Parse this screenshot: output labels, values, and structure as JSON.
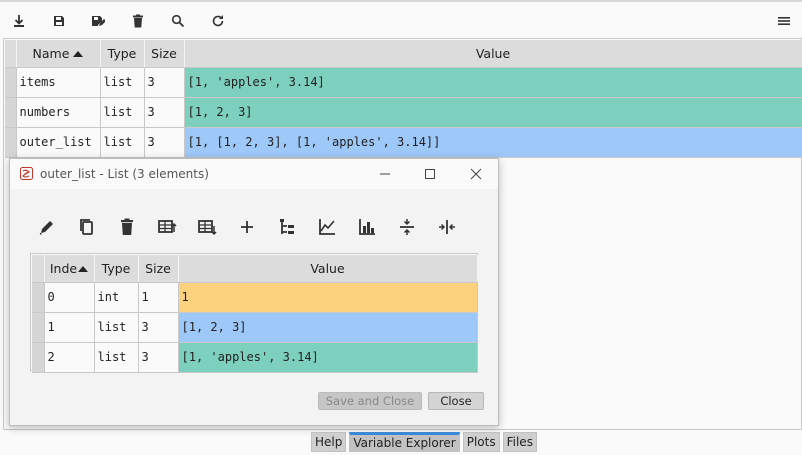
{
  "toolbar": {
    "icons": [
      "import-data-icon",
      "save-icon",
      "save-as-icon",
      "delete-all-icon",
      "search-icon",
      "refresh-icon",
      "options-menu-icon"
    ]
  },
  "main_table": {
    "headers": [
      "Name",
      "Type",
      "Size",
      "Value"
    ],
    "sort_column": "Name",
    "rows": [
      {
        "name": "items",
        "type": "list",
        "size": "3",
        "value": "[1, 'apples', 3.14]",
        "color": "#7dcfbe"
      },
      {
        "name": "numbers",
        "type": "list",
        "size": "3",
        "value": "[1, 2, 3]",
        "color": "#7dcfbe"
      },
      {
        "name": "outer_list",
        "type": "list",
        "size": "3",
        "value": "[1, [1, 2, 3], [1, 'apples', 3.14]]",
        "color": "#9ec8f8"
      }
    ]
  },
  "dialog": {
    "title": "outer_list - List (3 elements)",
    "toolbar_icons": [
      "edit-icon",
      "copy-icon",
      "remove-icon",
      "insert-above-icon",
      "insert-below-icon",
      "add-icon",
      "view-tree-icon",
      "plot-icon",
      "histogram-icon",
      "resize-rows-icon",
      "resize-columns-icon"
    ],
    "table": {
      "headers": [
        "Inde",
        "Type",
        "Size",
        "Value"
      ],
      "rows": [
        {
          "index": "0",
          "type": "int",
          "size": "1",
          "value": "1",
          "color": "#fdd27f"
        },
        {
          "index": "1",
          "type": "list",
          "size": "3",
          "value": "[1, 2, 3]",
          "color": "#9ec8f8"
        },
        {
          "index": "2",
          "type": "list",
          "size": "3",
          "value": "[1, 'apples', 3.14]",
          "color": "#7dcfbe"
        }
      ]
    },
    "save_and_close_label": "Save and Close",
    "close_label": "Close"
  },
  "tabs": [
    {
      "label": "Help",
      "active": false
    },
    {
      "label": "Variable Explorer",
      "active": true
    },
    {
      "label": "Plots",
      "active": false
    },
    {
      "label": "Files",
      "active": false
    }
  ]
}
